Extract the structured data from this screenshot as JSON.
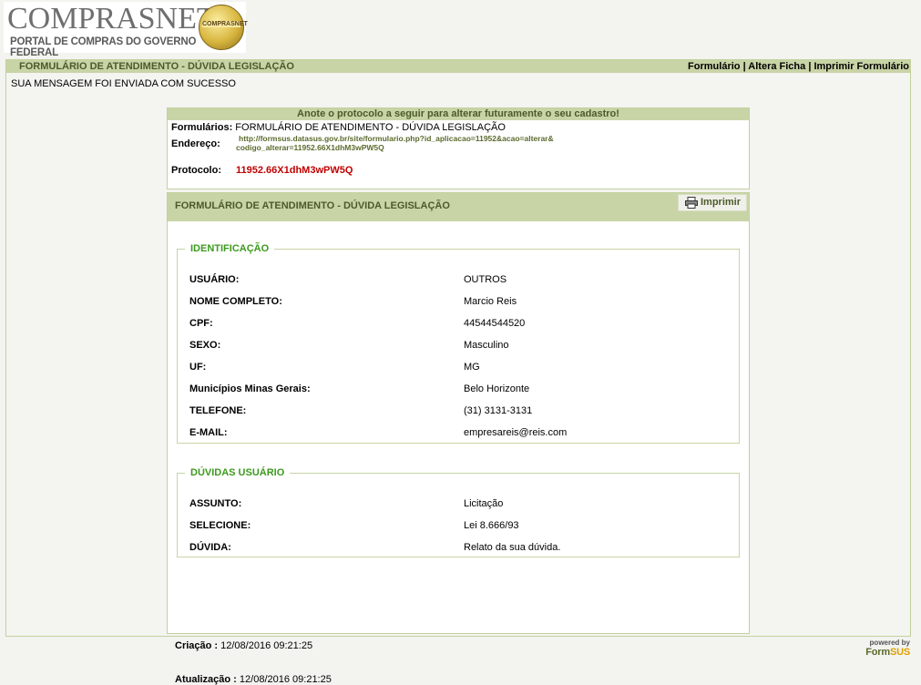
{
  "logo": {
    "title": "COMPRASNET",
    "subtitle": "PORTAL DE COMPRAS DO GOVERNO FEDERAL",
    "seal_text": "COMPRASNET"
  },
  "topbar": {
    "title": "FORMULÁRIO DE ATENDIMENTO - DÚVIDA LEGISLAÇÃO",
    "link_formulario": "Formulário",
    "sep": "|",
    "link_altera": "Altera Ficha",
    "link_imprimir": "Imprimir Formulário"
  },
  "success_message": "SUA MENSAGEM FOI ENVIADA COM SUCESSO",
  "protocol_box": {
    "header": "Anote o protocolo a seguir para alterar futuramente o seu cadastro!",
    "form_label": "Formulários:",
    "form_value": "FORMULÁRIO DE ATENDIMENTO - DÚVIDA LEGISLAÇÃO",
    "address_label": "Endereço:",
    "address_line1": "http://formsus.datasus.gov.br/site/formulario.php?id_aplicacao=11952&acao=alterar&",
    "address_line2": "codigo_alterar=11952.66X1dhM3wPW5Q",
    "protocol_label": "Protocolo:",
    "protocol_value": "11952.66X1dhM3wPW5Q"
  },
  "sheet": {
    "title": "FORMULÁRIO DE ATENDIMENTO - DÚVIDA LEGISLAÇÃO",
    "print_label": "Imprimir",
    "identificacao": {
      "legend": "IDENTIFICAÇÃO",
      "fields": [
        {
          "label": "USUÁRIO:",
          "value": "OUTROS"
        },
        {
          "label": "NOME COMPLETO:",
          "value": "Marcio Reis"
        },
        {
          "label": "CPF:",
          "value": "44544544520"
        },
        {
          "label": "SEXO:",
          "value": "Masculino"
        },
        {
          "label": "UF:",
          "value": "MG"
        },
        {
          "label": "Municípios Minas Gerais:",
          "value": "Belo Horizonte"
        },
        {
          "label": "TELEFONE:",
          "value": "(31) 3131-3131"
        },
        {
          "label": "E-MAIL:",
          "value": "empresareis@reis.com"
        }
      ]
    },
    "duvidas": {
      "legend": "DÚVIDAS USUÁRIO",
      "fields": [
        {
          "label": "ASSUNTO:",
          "value": "Licitação"
        },
        {
          "label": "SELECIONE:",
          "value": "Lei 8.666/93"
        },
        {
          "label": "DÚVIDA:",
          "value": "Relato da sua dúvida."
        }
      ]
    },
    "criacao_label": "Criação :",
    "criacao_value": "12/08/2016 09:21:25",
    "atualizacao_label": "Atualização :",
    "atualizacao_value": "12/08/2016 09:21:25"
  },
  "footer": {
    "powered_by": "powered by",
    "brand_a": "Form",
    "brand_b": "SUS"
  },
  "colors": {
    "header_green": "#c8d4a6",
    "title_green": "#4c5a2a",
    "legend_green": "#3c9a1e",
    "protocol_red": "#c00000"
  }
}
